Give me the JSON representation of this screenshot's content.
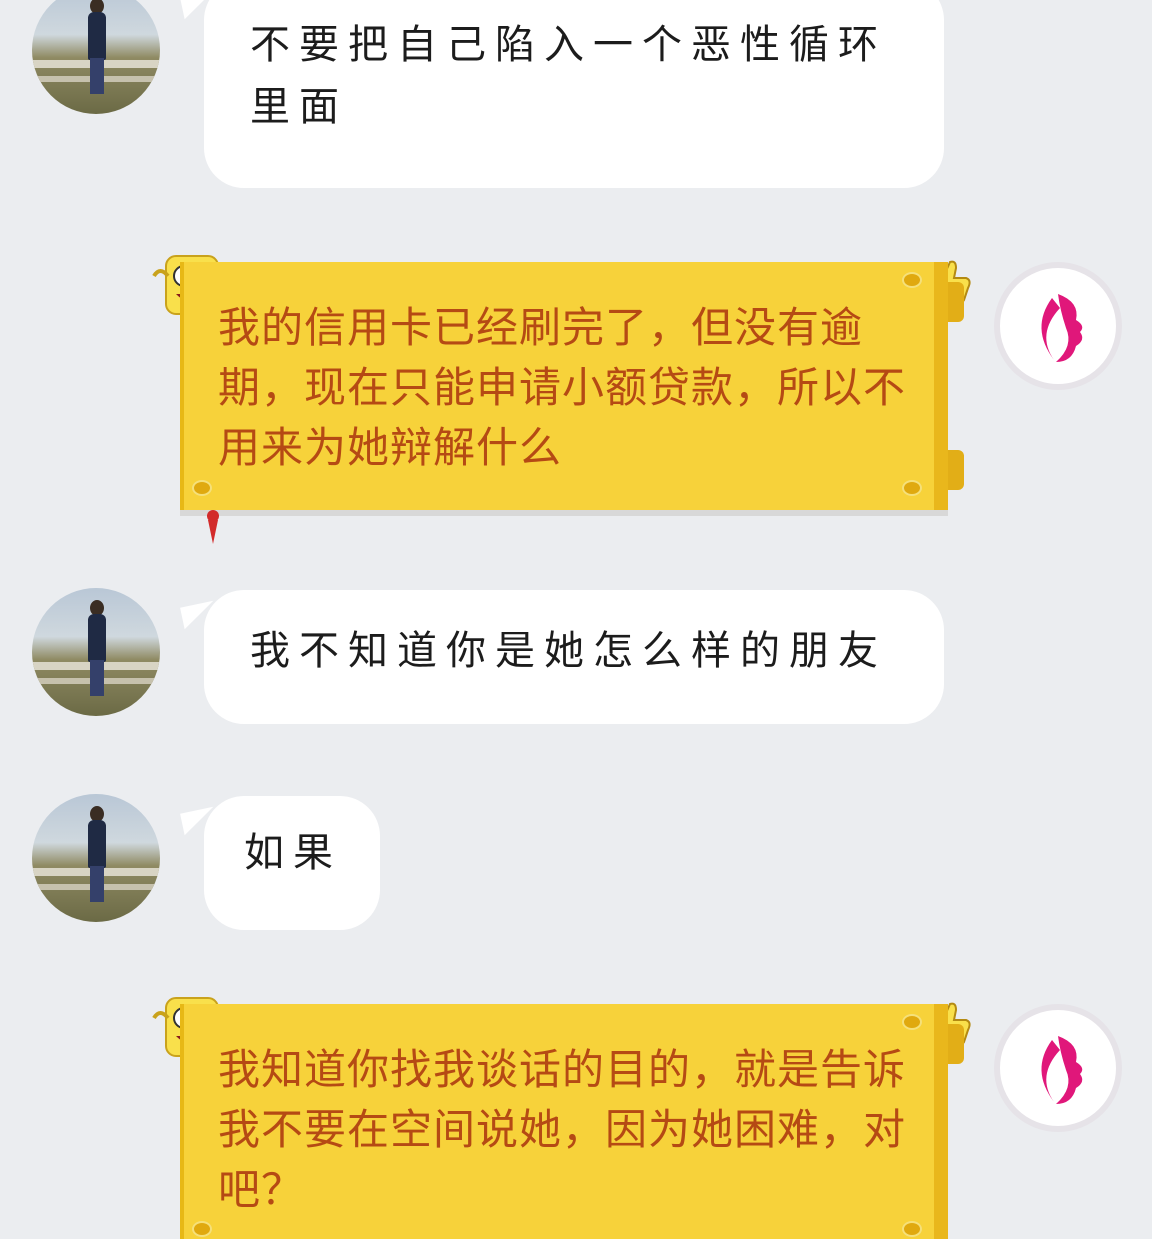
{
  "messages": [
    {
      "side": "incoming",
      "avatar_icon": "person-photo",
      "text": "不要把自己陷入一个恶性循环里面"
    },
    {
      "side": "outgoing",
      "avatar_icon": "brand-logo",
      "text": "我的信用卡已经刷完了，但没有逾期，现在只能申请小额贷款，所以不用来为她辩解什么"
    },
    {
      "side": "incoming",
      "avatar_icon": "person-photo",
      "text": "我不知道你是她怎么样的朋友"
    },
    {
      "side": "incoming",
      "avatar_icon": "person-photo",
      "text": "如果"
    },
    {
      "side": "outgoing",
      "avatar_icon": "brand-logo",
      "text": "我知道你找我谈话的目的，就是告诉我不要在空间说她，因为她困难，对吧？"
    }
  ],
  "colors": {
    "background": "#ebedf0",
    "incoming_bubble": "#ffffff",
    "outgoing_bubble": "#f7d23a",
    "outgoing_text": "#b54a14",
    "brand_logo": "#e0177a"
  }
}
